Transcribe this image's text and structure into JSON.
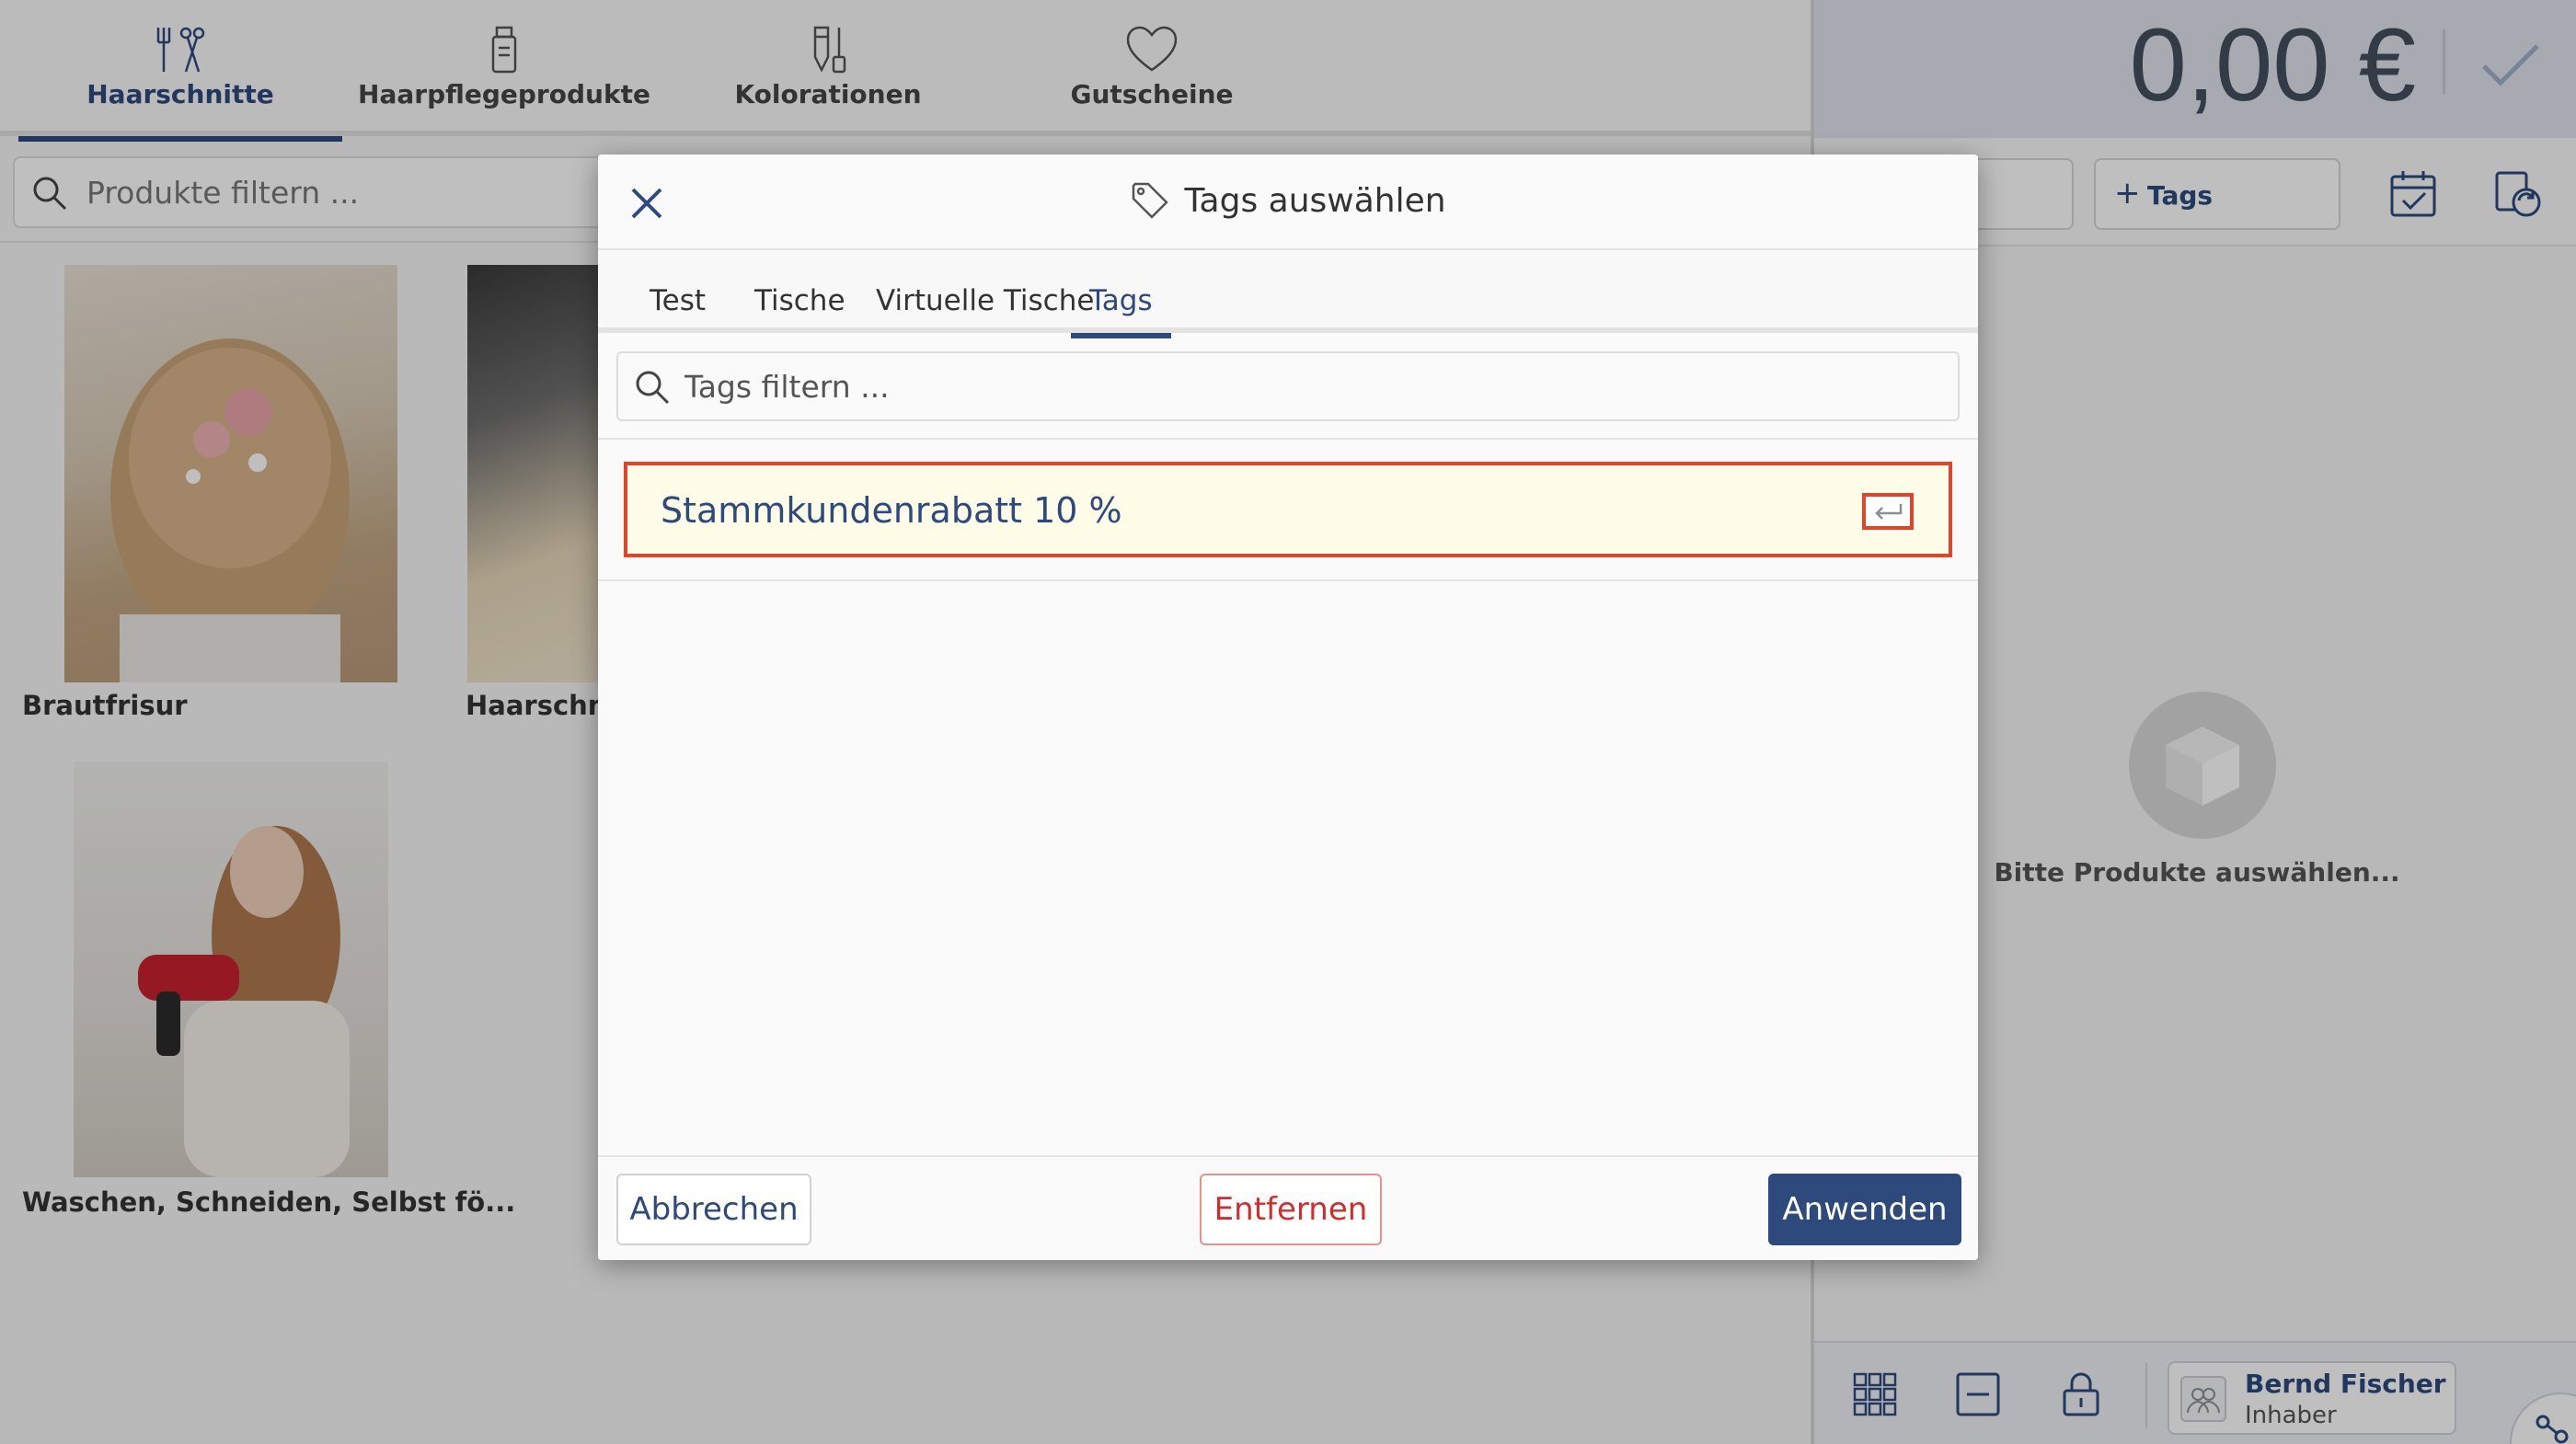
{
  "categories": [
    {
      "label": "Haarschnitte",
      "icon": "scissors-comb-icon",
      "active": true
    },
    {
      "label": "Haarpflegeprodukte",
      "icon": "hair-product-icon",
      "active": false
    },
    {
      "label": "Kolorationen",
      "icon": "coloring-tube-icon",
      "active": false
    },
    {
      "label": "Gutscheine",
      "icon": "heart-icon",
      "active": false
    }
  ],
  "product_filter": {
    "placeholder": "Produkte filtern ..."
  },
  "products": [
    {
      "name": "Brautfrisur"
    },
    {
      "name": "Haarschnitt"
    },
    {
      "name": "Waschen, Schneiden, Selbst fö..."
    }
  ],
  "cart": {
    "total": "0,00 €",
    "tags_button": "Tags",
    "empty_text": "Bitte Produkte auswählen..."
  },
  "user": {
    "name": "Bernd Fischer",
    "role": "Inhaber"
  },
  "modal": {
    "title": "Tags auswählen",
    "tabs": [
      "Test",
      "Tische",
      "Virtuelle Tische",
      "Tags"
    ],
    "active_tab": "Tags",
    "filter_placeholder": "Tags filtern ...",
    "new_tag_value": "Stammkundenrabatt 10 %",
    "buttons": {
      "cancel": "Abbrechen",
      "remove": "Entfernen",
      "apply": "Anwenden"
    }
  },
  "colors": {
    "primary": "#2e4a7d",
    "danger": "#d22d2d",
    "highlight_border": "#e0452a",
    "highlight_bg": "#fffde8"
  }
}
